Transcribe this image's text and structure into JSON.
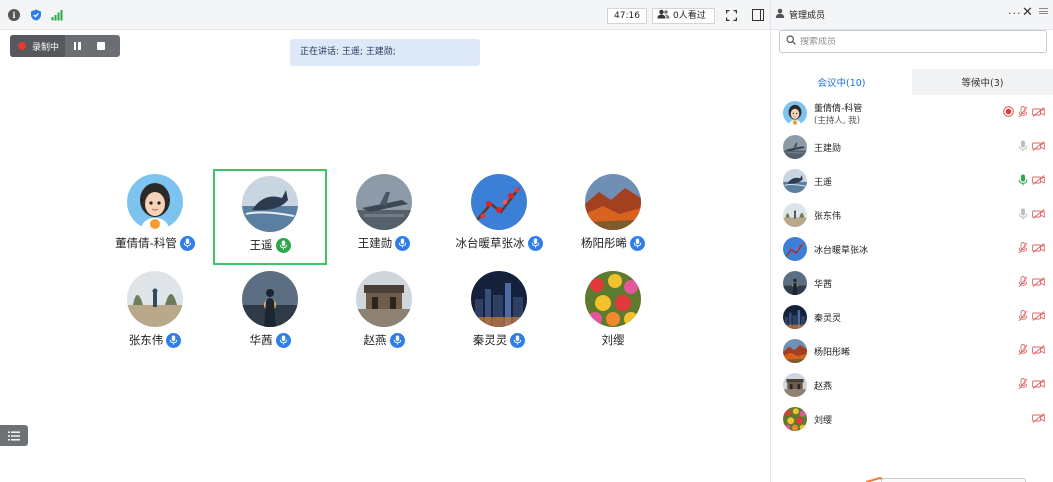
{
  "topbar": {
    "timer": "47:16",
    "viewers": "0人看过"
  },
  "recording": {
    "label": "录制中"
  },
  "speaking": {
    "text": "正在讲话: 王遥; 王建勋;"
  },
  "grid": [
    {
      "name": "董倩倩-科管",
      "mic": "blue",
      "active": false,
      "avatar": "cartoon"
    },
    {
      "name": "王遥",
      "mic": "green",
      "active": true,
      "avatar": "whale"
    },
    {
      "name": "王建勋",
      "mic": "blue",
      "active": false,
      "avatar": "jet"
    },
    {
      "name": "冰台暖草张冰",
      "mic": "blue",
      "active": false,
      "avatar": "plum"
    },
    {
      "name": "杨阳彤晞",
      "mic": "blue",
      "active": false,
      "avatar": "autumn"
    },
    {
      "name": "张东伟",
      "mic": "blue",
      "active": false,
      "avatar": "park"
    },
    {
      "name": "华茜",
      "mic": "blue",
      "active": false,
      "avatar": "sunset"
    },
    {
      "name": "赵燕",
      "mic": "blue",
      "active": false,
      "avatar": "gate"
    },
    {
      "name": "秦灵灵",
      "mic": "blue",
      "active": false,
      "avatar": "city"
    },
    {
      "name": "刘缨",
      "mic": "none",
      "active": false,
      "avatar": "flowers"
    }
  ],
  "panel": {
    "title": "管理成员",
    "search_placeholder": "搜索成员",
    "tabs": [
      {
        "label": "会议中(10)",
        "active": true
      },
      {
        "label": "等候中(3)",
        "active": false
      }
    ],
    "members": [
      {
        "name": "董倩倩-科管",
        "sub": "(主持人, 我)",
        "rec": true,
        "mic": "muted",
        "avatar": "cartoon"
      },
      {
        "name": "王建勋",
        "mic": "gray",
        "avatar": "jet"
      },
      {
        "name": "王遥",
        "mic": "green",
        "avatar": "whale"
      },
      {
        "name": "张东伟",
        "mic": "gray",
        "avatar": "park"
      },
      {
        "name": "冰台暖草张冰",
        "mic": "muted",
        "avatar": "plum"
      },
      {
        "name": "华茜",
        "mic": "muted",
        "avatar": "sunset"
      },
      {
        "name": "秦灵灵",
        "mic": "muted",
        "avatar": "city"
      },
      {
        "name": "杨阳彤晞",
        "mic": "muted",
        "avatar": "autumn"
      },
      {
        "name": "赵燕",
        "mic": "muted",
        "avatar": "gate"
      },
      {
        "name": "刘缨",
        "mic": "none",
        "avatar": "flowers"
      }
    ]
  },
  "colors": {
    "accent": "#1b6fe0",
    "active_border": "#3ec36b",
    "rec_red": "#e53935",
    "muted_red": "#e06666"
  }
}
